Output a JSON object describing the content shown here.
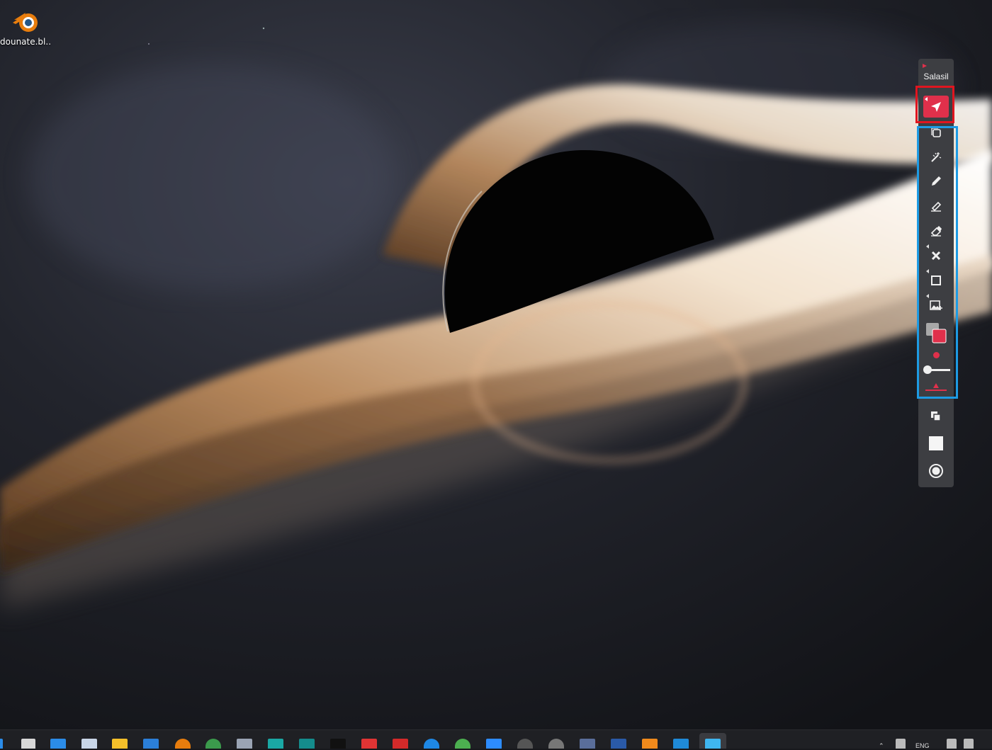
{
  "desktop": {
    "icons": [
      {
        "label": "dounate.bl...",
        "icon": "blender-icon"
      }
    ]
  },
  "toolbar": {
    "brand": "Salasil",
    "selected_tool": "pointer",
    "colors": {
      "accent": "#e0304b",
      "frame_red": "#e0151f",
      "frame_blue": "#1d9be4",
      "panel": "#3d3e42"
    },
    "tools": [
      "pointer-icon",
      "duplicate-icon",
      "laser-icon",
      "pen-icon",
      "highlighter-icon",
      "eraser-icon",
      "clear-icon",
      "shape-rectangle-icon",
      "image-add-icon",
      "color-swatch-icon",
      "brush-size-slider",
      "fill-icon",
      "layers-icon",
      "whiteboard-icon",
      "record-icon"
    ],
    "brush_size": 0.0
  },
  "taskbar": {
    "tray_language": "ENG",
    "apps": [
      "start-icon",
      "task-view-icon",
      "widgets-icon",
      "notepad-icon",
      "file-explorer-icon",
      "mail-icon",
      "blender-icon",
      "chrome-icon",
      "app-icon",
      "maya-icon",
      "3dsmax-icon",
      "epic-games-icon",
      "app-red-icon",
      "app-red2-icon",
      "app-blue-icon",
      "app-green-icon",
      "app-meet-icon",
      "obs-icon",
      "app-circle-icon",
      "app-rocket-icon",
      "powershell-icon",
      "vlc-icon",
      "vscode-icon",
      "flutter-icon"
    ]
  }
}
